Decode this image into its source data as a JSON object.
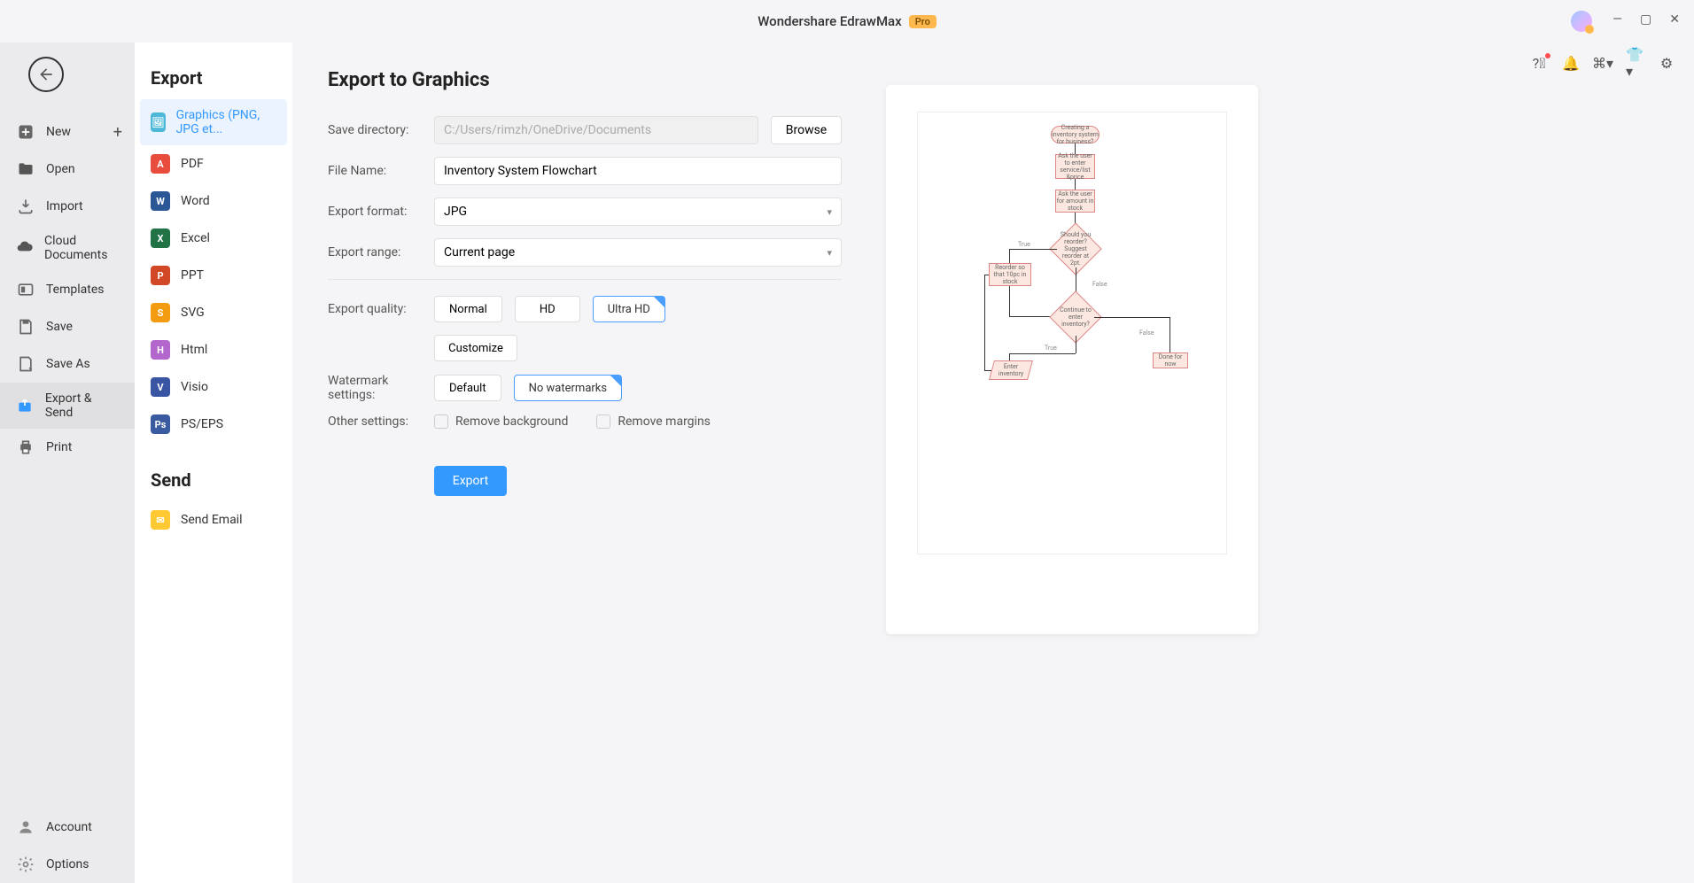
{
  "app": {
    "title": "Wondershare EdrawMax",
    "badge": "Pro"
  },
  "nav": {
    "new": "New",
    "open": "Open",
    "import": "Import",
    "cloud": "Cloud Documents",
    "templates": "Templates",
    "save": "Save",
    "saveas": "Save As",
    "exportsend": "Export & Send",
    "print": "Print",
    "account": "Account",
    "options": "Options"
  },
  "export": {
    "heading": "Export",
    "sendheading": "Send",
    "formats": {
      "graphics": "Graphics (PNG, JPG et...",
      "pdf": "PDF",
      "word": "Word",
      "excel": "Excel",
      "ppt": "PPT",
      "svg": "SVG",
      "html": "Html",
      "visio": "Visio",
      "pseps": "PS/EPS",
      "email": "Send Email"
    }
  },
  "form": {
    "title": "Export to Graphics",
    "savedir_label": "Save directory:",
    "savedir_value": "C:/Users/rimzh/OneDrive/Documents",
    "browse": "Browse",
    "filename_label": "File Name:",
    "filename_value": "Inventory System Flowchart",
    "format_label": "Export format:",
    "format_value": "JPG",
    "range_label": "Export range:",
    "range_value": "Current page",
    "quality_label": "Export quality:",
    "quality_normal": "Normal",
    "quality_hd": "HD",
    "quality_ultra": "Ultra HD",
    "customize": "Customize",
    "watermark_label": "Watermark settings:",
    "watermark_default": "Default",
    "watermark_none": "No watermarks",
    "other_label": "Other settings:",
    "remove_bg": "Remove background",
    "remove_margins": "Remove margins",
    "export_btn": "Export"
  },
  "flowchart": {
    "n1": "Creating a inventory system for business?",
    "n2": "Ask the user to enter service/list &price",
    "n3": "Ask the user for amount in stock",
    "n4": "Should you reorder? Suggest reorder at 2pt.",
    "true1": "True",
    "false1": "False",
    "n5": "Reorder so that 10pc in stock",
    "n6": "Continue to enter inventory?",
    "true2": "True",
    "false2": "False",
    "n7": "Enter inventory",
    "n8": "Done for now"
  }
}
